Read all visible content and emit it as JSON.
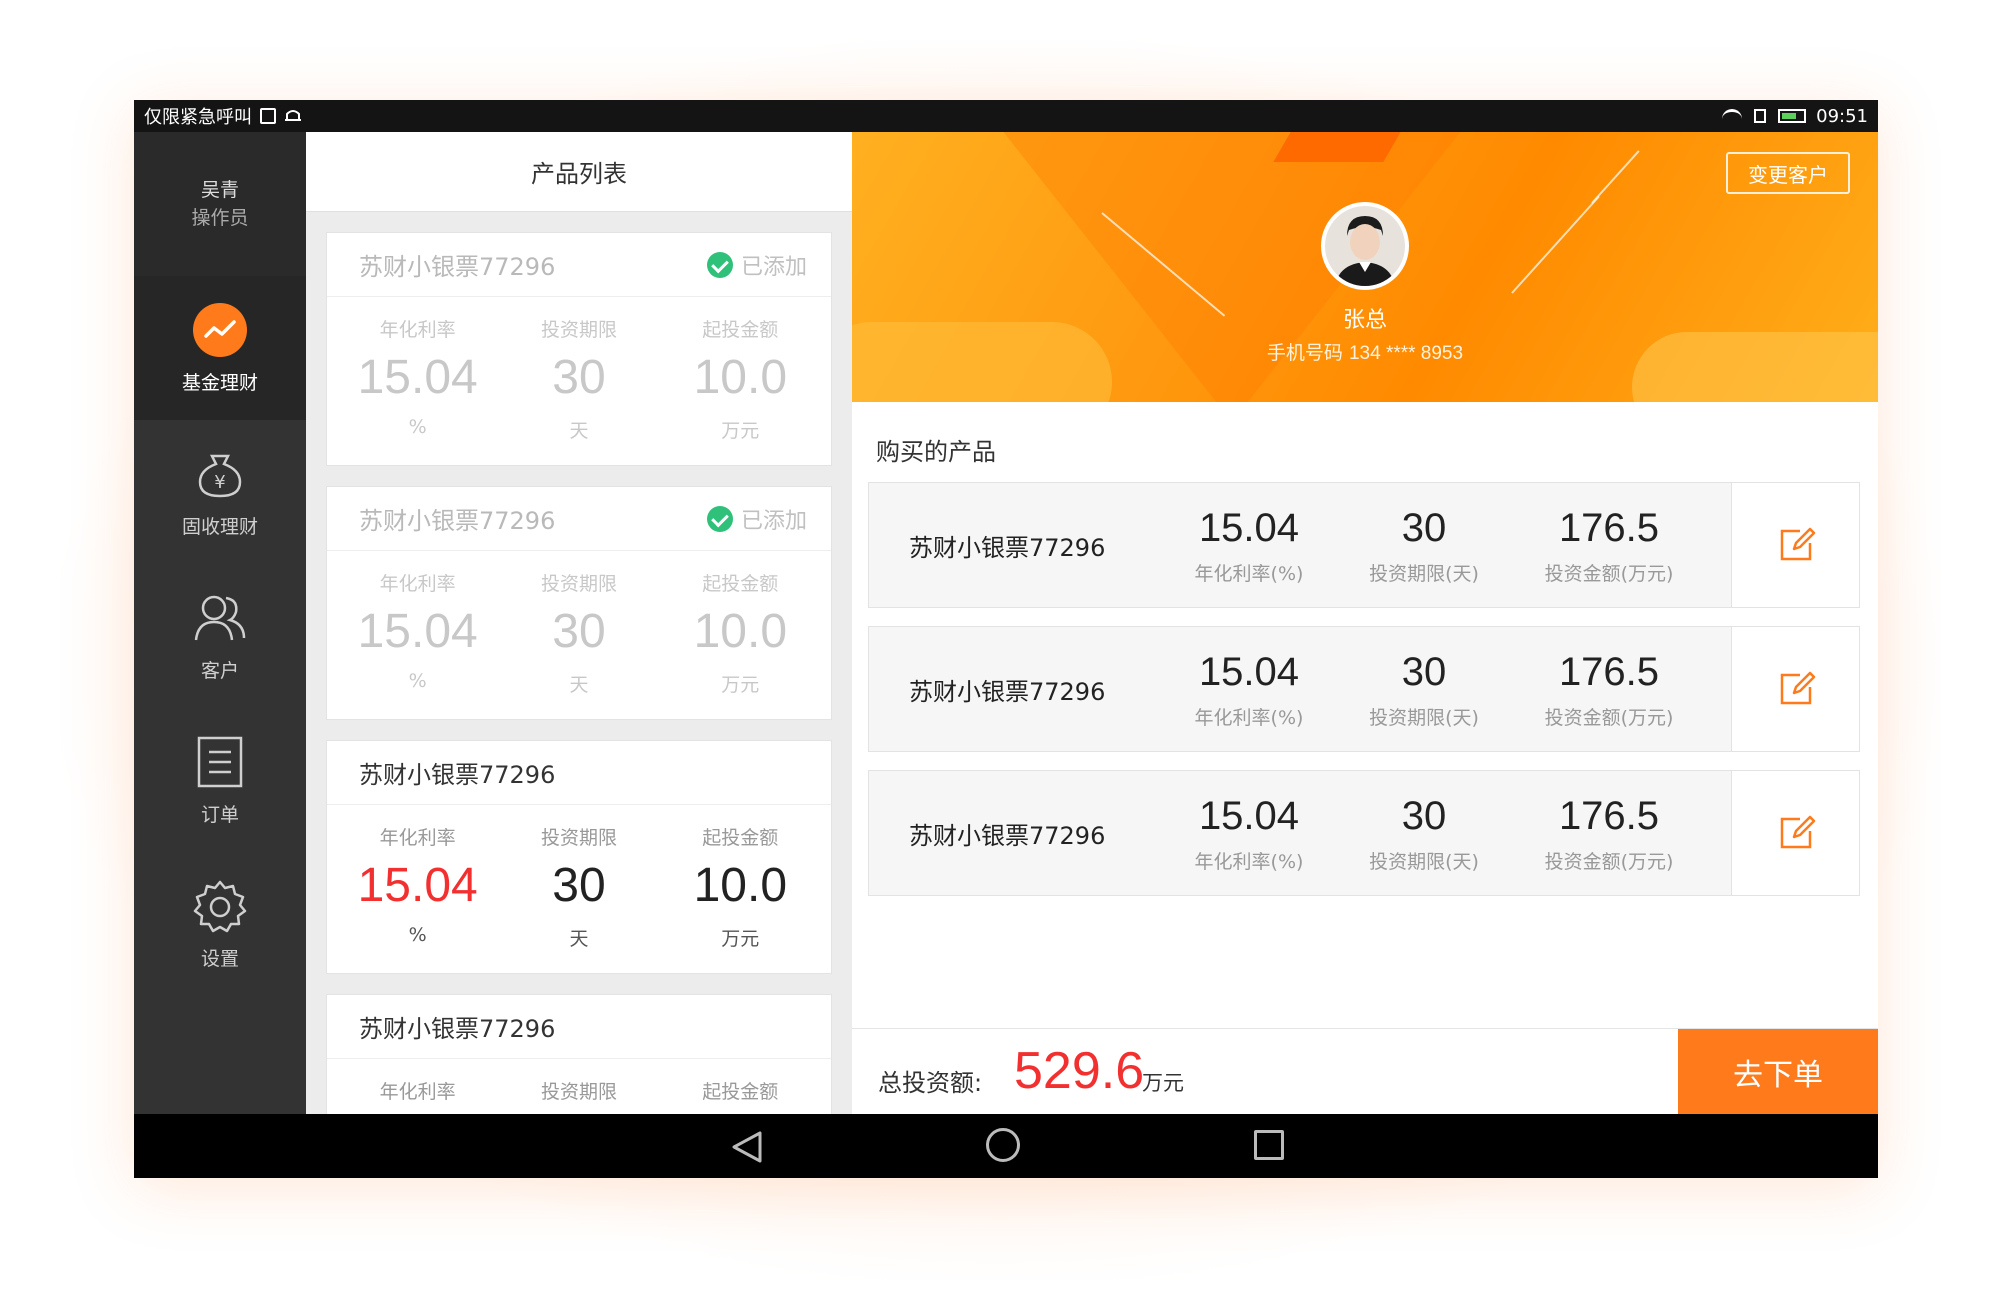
{
  "status_bar": {
    "left_text": "仅限紧急呼叫",
    "time": "09:51"
  },
  "sidebar": {
    "user_name": "吴青",
    "user_role": "操作员",
    "items": [
      {
        "label": "基金理财",
        "icon": "trend-chart-icon",
        "active": true
      },
      {
        "label": "固收理财",
        "icon": "money-bag-icon",
        "active": false
      },
      {
        "label": "客户",
        "icon": "users-icon",
        "active": false
      },
      {
        "label": "订单",
        "icon": "document-list-icon",
        "active": false
      },
      {
        "label": "设置",
        "icon": "gear-icon",
        "active": false
      }
    ]
  },
  "product_list": {
    "title": "产品列表",
    "added_label": "已添加",
    "cards": [
      {
        "name": "苏财小银票77296",
        "added": true,
        "labels": [
          "年化利率",
          "投资期限",
          "起投金额"
        ],
        "values": [
          "15.04",
          "30",
          "10.0"
        ],
        "units": [
          "%",
          "天",
          "万元"
        ]
      },
      {
        "name": "苏财小银票77296",
        "added": true,
        "labels": [
          "年化利率",
          "投资期限",
          "起投金额"
        ],
        "values": [
          "15.04",
          "30",
          "10.0"
        ],
        "units": [
          "%",
          "天",
          "万元"
        ]
      },
      {
        "name": "苏财小银票77296",
        "added": false,
        "labels": [
          "年化利率",
          "投资期限",
          "起投金额"
        ],
        "values": [
          "15.04",
          "30",
          "10.0"
        ],
        "units": [
          "%",
          "天",
          "万元"
        ]
      },
      {
        "name": "苏财小银票77296",
        "added": false,
        "labels": [
          "年化利率",
          "投资期限",
          "起投金额"
        ],
        "values": [
          "",
          "",
          ""
        ],
        "units": [
          "",
          "",
          ""
        ]
      }
    ]
  },
  "customer": {
    "change_button": "变更客户",
    "name": "张总",
    "phone_label": "手机号码",
    "phone": "134 **** 8953"
  },
  "bought": {
    "title": "购买的产品",
    "rows": [
      {
        "name": "苏财小银票77296",
        "rate": "15.04",
        "rate_label": "年化利率(%)",
        "term": "30",
        "term_label": "投资期限(天)",
        "amount": "176.5",
        "amount_label": "投资金额(万元)"
      },
      {
        "name": "苏财小银票77296",
        "rate": "15.04",
        "rate_label": "年化利率(%)",
        "term": "30",
        "term_label": "投资期限(天)",
        "amount": "176.5",
        "amount_label": "投资金额(万元)"
      },
      {
        "name": "苏财小银票77296",
        "rate": "15.04",
        "rate_label": "年化利率(%)",
        "term": "30",
        "term_label": "投资期限(天)",
        "amount": "176.5",
        "amount_label": "投资金额(万元)"
      }
    ]
  },
  "footer": {
    "total_label": "总投资额:",
    "total_value": "529.6",
    "total_unit": "万元",
    "order_button": "去下单"
  },
  "colors": {
    "accent": "#ff7a1a",
    "highlight_red": "#f23030",
    "added_green": "#2fc17a"
  }
}
